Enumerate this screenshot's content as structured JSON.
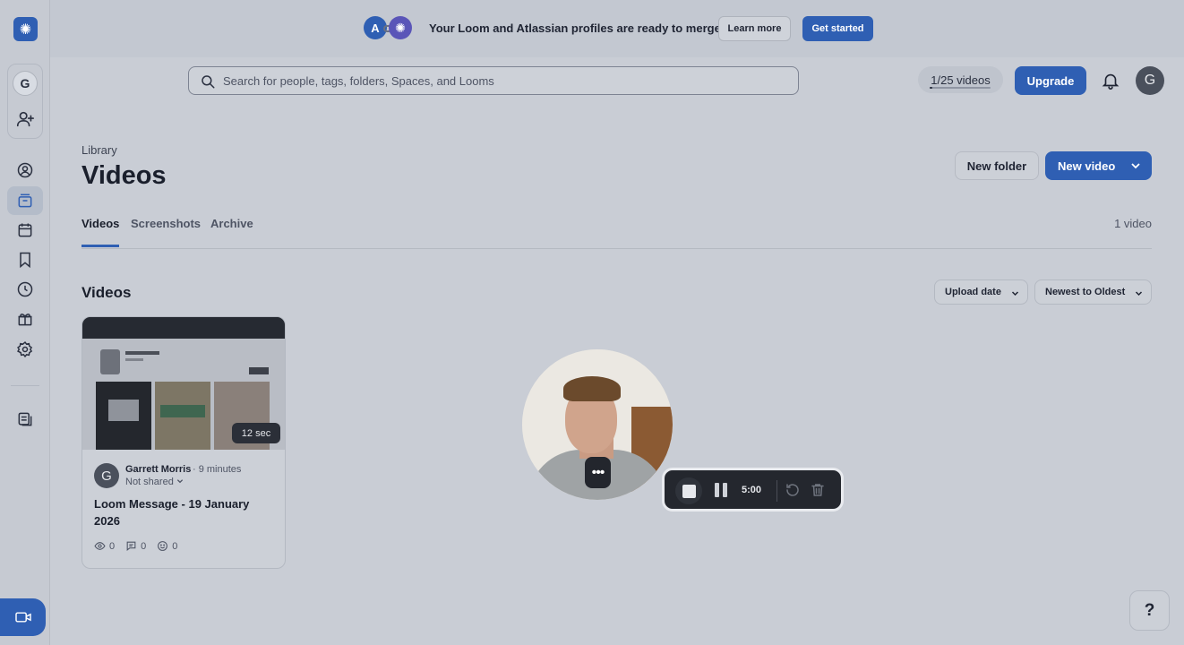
{
  "banner": {
    "message": "Your Loom and Atlassian profiles are ready to merge",
    "learn_more": "Learn more",
    "get_started": "Get started",
    "atlassian_glyph": "A"
  },
  "sidebar": {
    "workspace_initial": "G",
    "items": [
      {
        "name": "profile-icon"
      },
      {
        "name": "library-icon",
        "active": true
      },
      {
        "name": "calendar-icon"
      },
      {
        "name": "bookmark-icon"
      },
      {
        "name": "clock-icon"
      },
      {
        "name": "gift-icon"
      },
      {
        "name": "settings-icon"
      },
      {
        "name": "notes-icon"
      }
    ]
  },
  "header": {
    "search_placeholder": "Search for people, tags, folders, Spaces, and Looms",
    "usage_label": "1/25 videos",
    "usage_fraction": 0.04,
    "upgrade": "Upgrade",
    "user_initial": "G"
  },
  "main": {
    "breadcrumb": "Library",
    "title": "Videos",
    "new_folder": "New folder",
    "new_video": "New video",
    "tabs": [
      "Videos",
      "Screenshots",
      "Archive"
    ],
    "active_tab": "Videos",
    "video_count": "1 video",
    "section_title": "Videos",
    "sort_field": "Upload date",
    "sort_order": "Newest to Oldest"
  },
  "video_card": {
    "duration": "12 sec",
    "author_initial": "G",
    "author": "Garrett Morris",
    "time_ago": "· 9 minutes",
    "sharing": "Not shared",
    "title": "Loom Message - 19 January 2026",
    "views": "0",
    "comments": "0",
    "reactions": "0"
  },
  "recorder": {
    "more_glyph": "•••",
    "timer": "5:00"
  },
  "help": "?",
  "colors": {
    "accent": "#2f5fb3",
    "background": "#c9cdd5",
    "recorder_bar": "#24272e"
  }
}
